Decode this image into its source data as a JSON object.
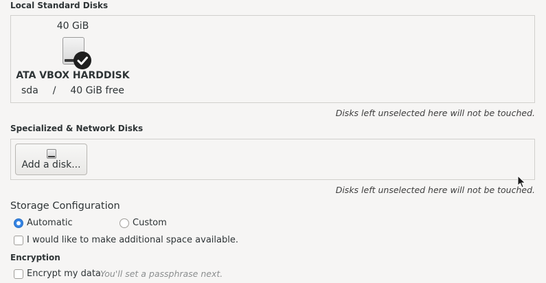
{
  "local_disks": {
    "title": "Local Standard Disks",
    "disk": {
      "size": "40 GiB",
      "name": "ATA VBOX HARDDISK",
      "device": "sda",
      "separator": "/",
      "free": "40 GiB free",
      "selected": true,
      "icon": "harddisk-icon"
    },
    "note": "Disks left unselected here will not be touched."
  },
  "network_disks": {
    "title": "Specialized & Network Disks",
    "add_button": "Add a disk...",
    "note": "Disks left unselected here will not be touched."
  },
  "storage_config": {
    "title": "Storage Configuration",
    "options": [
      {
        "label": "Automatic",
        "selected": true
      },
      {
        "label": "Custom",
        "selected": false
      }
    ],
    "additional_space": {
      "label": "I would like to make additional space available.",
      "checked": false
    }
  },
  "encryption": {
    "title": "Encryption",
    "checkbox_label": "Encrypt my data.",
    "hint": "You'll set a passphrase next.",
    "checked": false
  },
  "colors": {
    "accent": "#3584e4",
    "background": "#f6f5f4"
  }
}
